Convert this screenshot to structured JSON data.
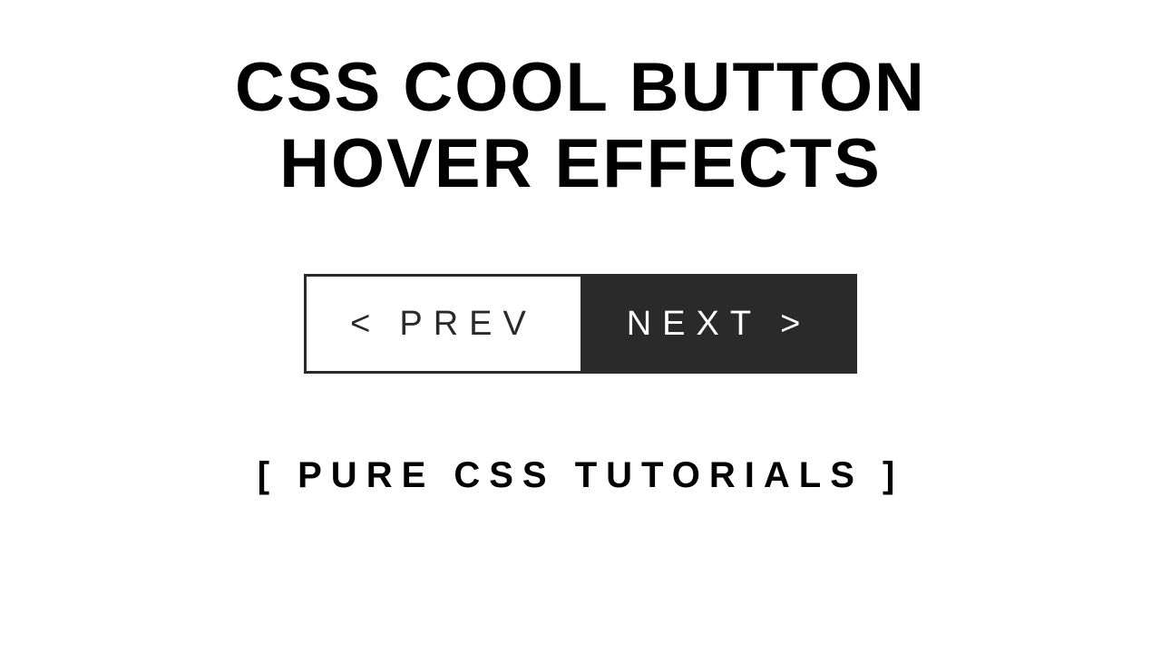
{
  "title": {
    "line1": "CSS COOL BUTTON",
    "line2": "HOVER EFFECTS"
  },
  "buttons": {
    "prev": {
      "icon": "<",
      "label": "PREV"
    },
    "next": {
      "label": "NEXT",
      "icon": ">"
    }
  },
  "subtitle": "[ PURE CSS TUTORIALS ]"
}
